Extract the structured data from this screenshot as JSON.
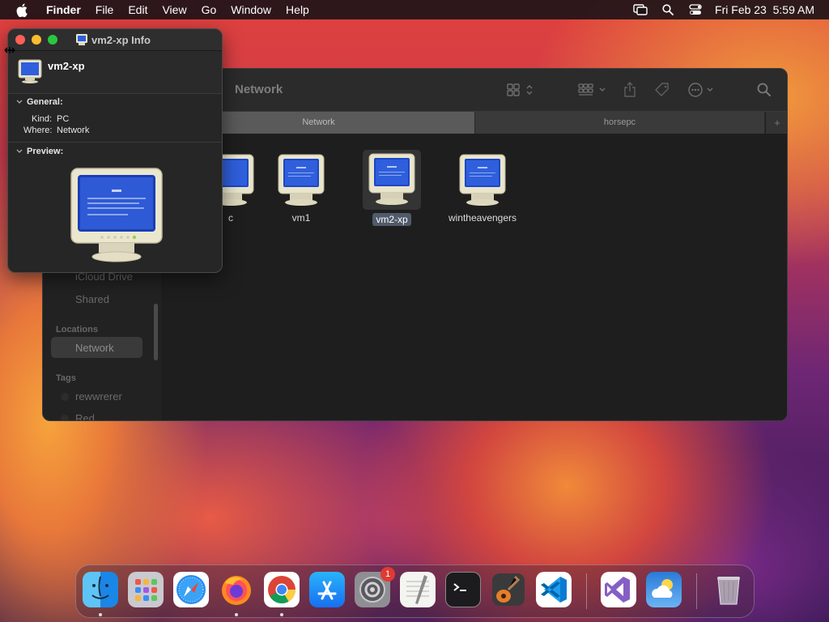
{
  "menubar": {
    "app": "Finder",
    "items": [
      "File",
      "Edit",
      "View",
      "Go",
      "Window",
      "Help"
    ],
    "datetime": "Fri Feb 23  5:59 AM",
    "icons": [
      "screen-mirroring-icon",
      "spotlight-search-icon",
      "control-center-icon"
    ]
  },
  "finder": {
    "title": "Network",
    "tabs": [
      "Network",
      "horsepc"
    ],
    "new_tab": "+",
    "sidebar": {
      "items_top": [
        "iCloud Drive",
        "Shared"
      ],
      "locations_header": "Locations",
      "locations": [
        "Network"
      ],
      "tags_header": "Tags",
      "tags": [
        "rewwrerer",
        "Red"
      ]
    },
    "items": [
      {
        "label": "c",
        "icon": "crt-monitor-icon"
      },
      {
        "label": "vm1",
        "icon": "crt-monitor-icon"
      },
      {
        "label": "vm2-xp",
        "icon": "crt-monitor-icon",
        "selected": true
      },
      {
        "label": "wintheavengers",
        "icon": "crt-monitor-icon"
      }
    ]
  },
  "info": {
    "title": "vm2-xp Info",
    "name": "vm2-xp",
    "general_label": "General:",
    "kind_label": "Kind:",
    "kind_value": "PC",
    "where_label": "Where:",
    "where_value": "Network",
    "preview_label": "Preview:"
  },
  "dock": {
    "apps": [
      "Finder",
      "Launchpad",
      "Safari",
      "Firefox",
      "Chrome",
      "App Store",
      "System Settings",
      "TextEdit",
      "Terminal",
      "GarageBand",
      "Visual Studio Code",
      "Visual Studio",
      "Weather",
      "Trash"
    ],
    "badge": "1"
  },
  "colors": {
    "close": "#ff5f57",
    "minimize": "#febc2e",
    "zoom": "#28c840",
    "selection": "#505a6a"
  }
}
